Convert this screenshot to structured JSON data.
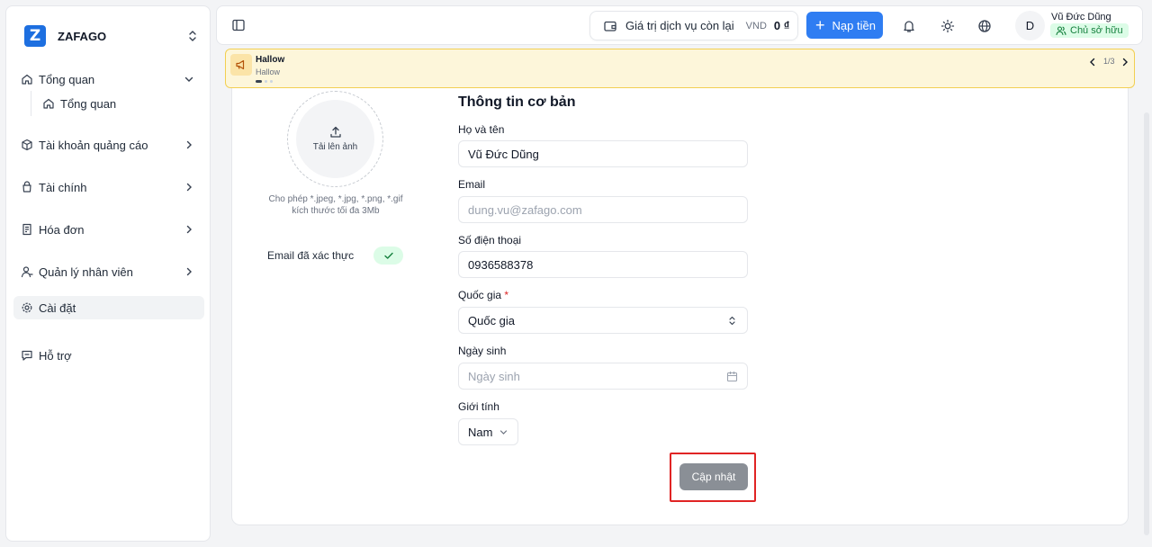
{
  "brand": {
    "logo_letter": "Z",
    "name": "ZAFAGO"
  },
  "sidebar": {
    "items": [
      {
        "label": "Tổng quan",
        "icon": "home-icon"
      },
      {
        "label": "Tổng quan",
        "icon": "home-icon"
      },
      {
        "label": "Tài khoản quảng cáo",
        "icon": "box-icon"
      },
      {
        "label": "Tài chính",
        "icon": "wallet-icon"
      },
      {
        "label": "Hóa đơn",
        "icon": "receipt-icon"
      },
      {
        "label": "Quản lý nhân viên",
        "icon": "user-icon"
      },
      {
        "label": "Cài đặt",
        "icon": "gear-icon"
      },
      {
        "label": "Hỗ trợ",
        "icon": "chat-icon"
      }
    ]
  },
  "header": {
    "balance_label": "Giá trị dịch vụ còn lại",
    "currency": "VND",
    "balance_amount": "0 ₫",
    "topup_label": "Nạp tiền",
    "avatar_letter": "D",
    "user_name": "Vũ Đức Dũng",
    "role": "Chủ sở hữu"
  },
  "announcement": {
    "title": "Hallow",
    "subtitle": "Hallow",
    "page": "1/3"
  },
  "profile": {
    "upload_label": "Tải lên ảnh",
    "upload_hint_1": "Cho phép *.jpeg, *.jpg, *.png, *.gif",
    "upload_hint_2": "kích thước tối đa 3Mb",
    "email_verified_label": "Email đã xác thực"
  },
  "form": {
    "section_title": "Thông tin cơ bản",
    "full_name_label": "Họ và tên",
    "full_name_value": "Vũ Đức Dũng",
    "email_label": "Email",
    "email_placeholder": "dung.vu@zafago.com",
    "phone_label": "Số điện thoại",
    "phone_value": "0936588378",
    "country_label": "Quốc gia",
    "required_mark": "*",
    "country_value": "Quốc gia",
    "dob_label": "Ngày sinh",
    "dob_placeholder": "Ngày sinh",
    "gender_label": "Giới tính",
    "gender_value": "Nam",
    "submit_label": "Cập nhật"
  },
  "colors": {
    "primary": "#2f7df2",
    "success_bg": "#dcfce7",
    "success_text": "#15803d",
    "announce_bg": "#fdf6da",
    "announce_border": "#f2cf52",
    "highlight": "#e02424"
  }
}
